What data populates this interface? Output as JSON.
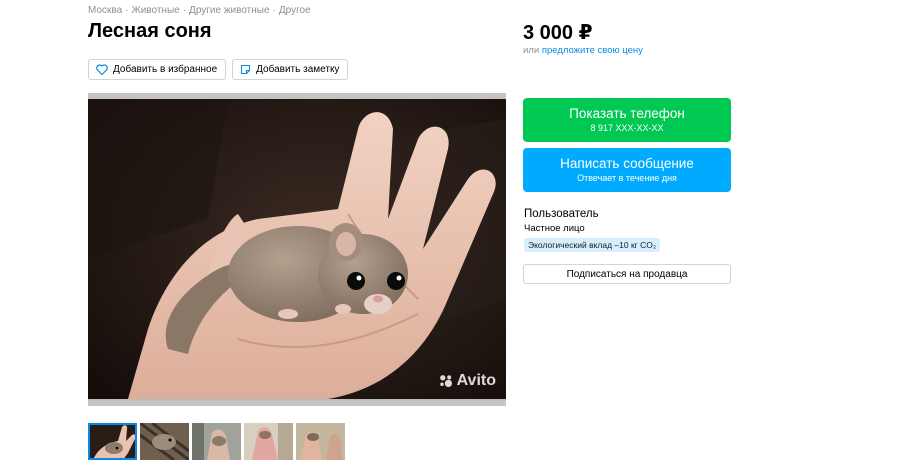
{
  "breadcrumb": [
    "Москва",
    "Животные",
    "Другие животные",
    "Другое"
  ],
  "breadcrumb_separator": "·",
  "title": "Лесная соня",
  "favorite_label": "Добавить в избранное",
  "note_label": "Добавить заметку",
  "price": "3 000 ₽",
  "price_prefix": "или",
  "price_offer_link": "предложите свою цену",
  "phone_button": {
    "label": "Показать телефон",
    "number": "8 917 XXX-XX-XX"
  },
  "message_button": {
    "label": "Написать сообщение",
    "sub": "Отвечает в течение дня"
  },
  "seller": {
    "name": "Пользователь",
    "type": "Частное лицо",
    "eco_badge": "Экологический вклад –10 кг CO₂"
  },
  "subscribe_label": "Подписаться на продавца",
  "watermark": "Avito",
  "thumbnail_count": 5,
  "active_thumbnail": 1,
  "colors": {
    "phone_button": "#00c853",
    "message_button": "#00aaff",
    "link": "#0a8ae6",
    "eco_badge": "#d6efff"
  },
  "icons": [
    "heart-icon",
    "note-icon",
    "avito-logo-icon"
  ]
}
